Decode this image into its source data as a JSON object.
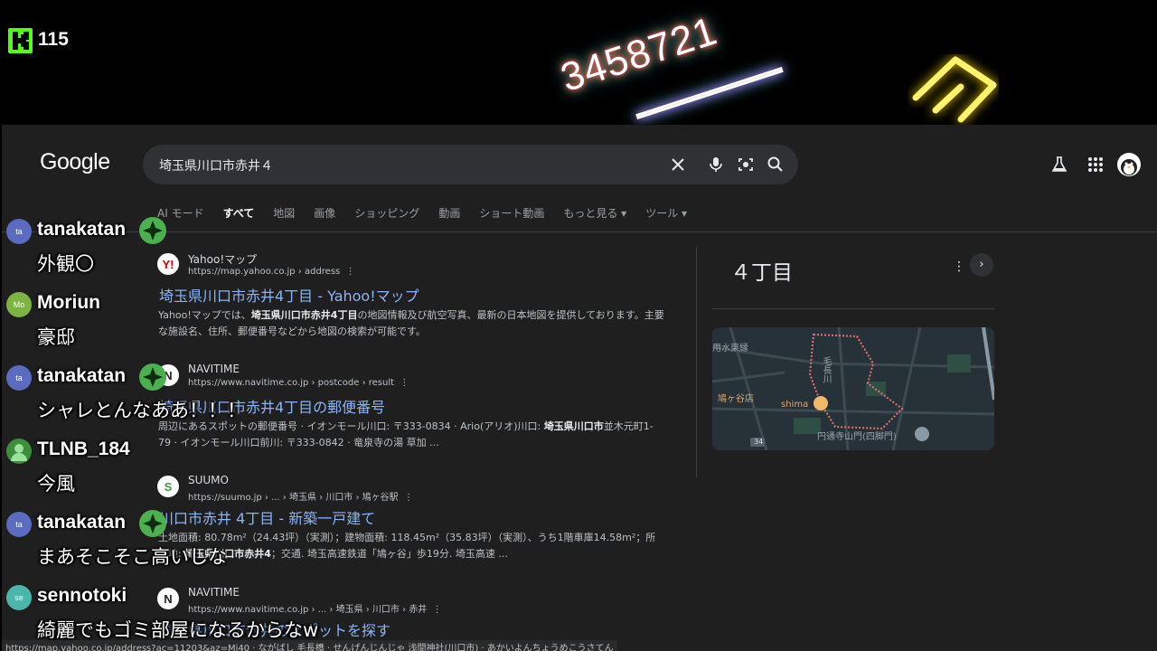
{
  "stream": {
    "viewer_count": "115",
    "neon_number": "3458721"
  },
  "google": {
    "logo": "Google",
    "search_query": "埼玉県川口市赤井４",
    "tabs": [
      "AI モード",
      "すべて",
      "地図",
      "画像",
      "ショッピング",
      "動画",
      "ショート動画",
      "もっと見る ▾",
      "ツール ▾"
    ],
    "active_tab": "すべて",
    "results": [
      {
        "favicon": "Y!",
        "site": "Yahoo!マップ",
        "url": "https://map.yahoo.co.jp › address",
        "title": "埼玉県川口市赤井4丁目 - Yahoo!マップ",
        "snippet_1": "Yahoo!マップでは、",
        "snippet_bold": "埼玉県川口市赤井4丁目",
        "snippet_2": "の地図情報及び航空写真、最新の日本地図を提供しております。主要な施設名、住所、郵便番号などから地図の検索が可能です。"
      },
      {
        "favicon": "N",
        "site": "NAVITIME",
        "url": "https://www.navitime.co.jp › postcode › result",
        "title": "埼玉県川口市赤井4丁目の郵便番号",
        "snippet_1": "周辺にあるスポットの郵便番号 · イオンモール川口: 〒333-0834 · Ario(アリオ)川口: ",
        "snippet_bold": "埼玉県川口市",
        "snippet_2": "並木元町1-79 · イオンモール川口前川: 〒333-0842 · 竜泉寺の湯 草加 ..."
      },
      {
        "favicon": "S",
        "site": "SUUMO",
        "url": "https://suumo.jp › ... › 埼玉県 › 川口市 › 鳩ヶ谷駅",
        "title": "川口市赤井 4丁目 - 新築一戸建て",
        "snippet_1": "土地面積: 80.78m²（24.43坪）（実測）；建物面積: 118.45m²（35.83坪）（実測）、うち1階車庫14.58m²；所在地: ",
        "snippet_bold": "埼玉県川口市赤井4",
        "snippet_2": "；交通. 埼玉高速鉄道「鳩ヶ谷」歩19分. 埼玉高速 ..."
      },
      {
        "favicon": "N",
        "site": "NAVITIME",
        "url": "https://www.navitime.co.jp › ... › 埼玉県 › 川口市 › 赤井",
        "title": "埼玉県川口市赤井のスポットを探す",
        "snippet_1": "",
        "snippet_bold": "",
        "snippet_2": ""
      }
    ],
    "knowledge_panel": {
      "title": "４丁目",
      "map_labels": {
        "route": "用水東縁",
        "river": "毛長川",
        "place1": "鳩ヶ谷店",
        "place2": "shima",
        "place3": "円通寺山門(四脚門)",
        "road": "34"
      }
    },
    "status_url": "https://map.yahoo.co.jp/address?ac=11203&az=Mi40 · ながばし 毛長橋 · せんげんじんじゃ 浅間神社(川口市) · あかいよんちょうめこうさてん"
  },
  "chat": [
    {
      "avatar": "ta",
      "avatar_color": "#5b6bc0",
      "user": "tanakatan",
      "badge": true,
      "text": "外観〇"
    },
    {
      "avatar": "Mo",
      "avatar_color": "#7cb342",
      "user": "Moriun",
      "badge": false,
      "text": "豪邸"
    },
    {
      "avatar": "ta",
      "avatar_color": "#5b6bc0",
      "user": "tanakatan",
      "badge": true,
      "text": "シャレとんなああ！！！"
    },
    {
      "avatar": "",
      "avatar_color": "#3c8d3c",
      "user": "TLNB_184",
      "badge": false,
      "text": "今風"
    },
    {
      "avatar": "ta",
      "avatar_color": "#5b6bc0",
      "user": "tanakatan",
      "badge": true,
      "text": "まあそこそこ高いしな"
    },
    {
      "avatar": "se",
      "avatar_color": "#4db6ac",
      "user": "sennotoki",
      "badge": false,
      "text": "綺麗でもゴミ部屋になるからなw"
    }
  ]
}
